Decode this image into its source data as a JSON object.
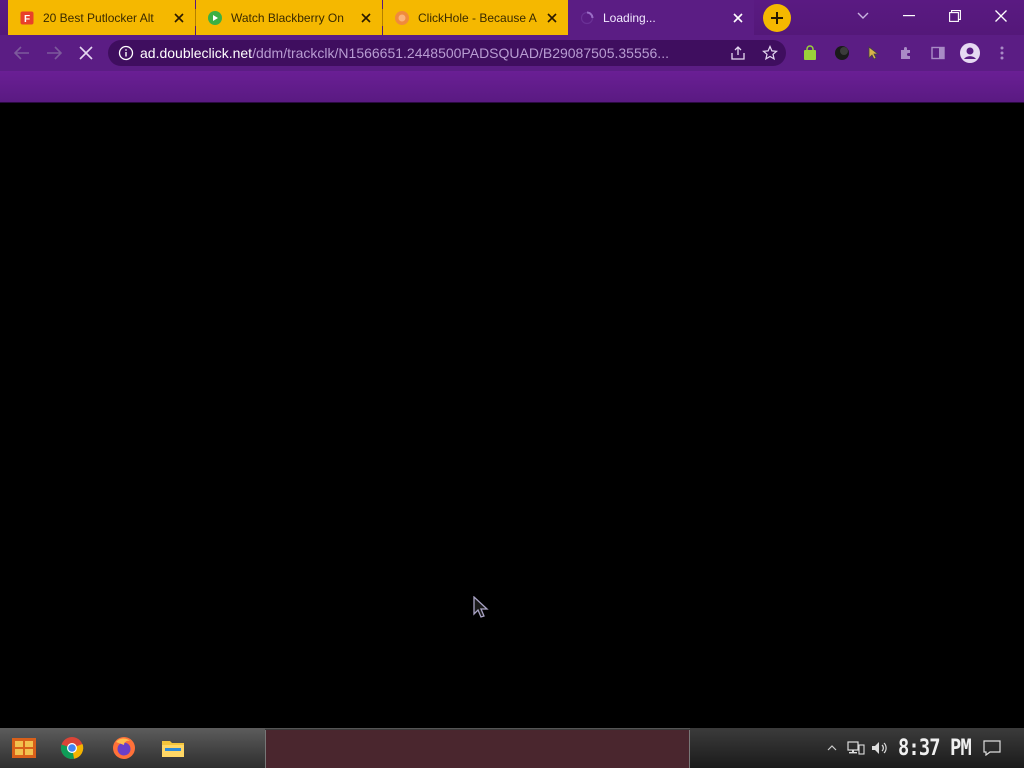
{
  "browser": {
    "tabs": [
      {
        "title": "20 Best Putlocker Alt",
        "favicon": "letter-f-icon",
        "active": false
      },
      {
        "title": "Watch Blackberry On",
        "favicon": "play-icon",
        "active": false
      },
      {
        "title": "ClickHole - Because A",
        "favicon": "clickhole-icon",
        "active": false
      },
      {
        "title": "Loading...",
        "favicon": "loading-spinner-icon",
        "active": true
      }
    ],
    "url_host": "ad.doubleclick.net",
    "url_path": "/ddm/trackclk/N1566651.2448500PADSQUAD/B29087505.35556...",
    "colors": {
      "chrome_purple": "#5b1d84",
      "tab_yellow": "#f5b800",
      "omnibox_bg": "#3f0e5f"
    }
  },
  "taskbar": {
    "clock": "8:37 PM",
    "pinned": [
      "start-icon",
      "chrome-icon",
      "firefox-icon",
      "file-explorer-icon"
    ],
    "tray": [
      "chevron-up-icon",
      "network-icon",
      "volume-icon",
      "notification-icon"
    ]
  }
}
